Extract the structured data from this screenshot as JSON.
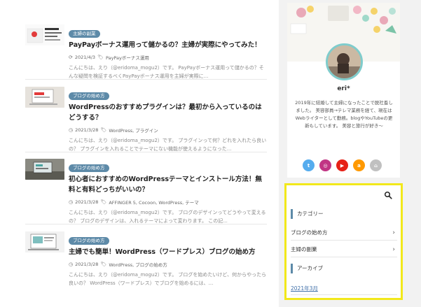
{
  "posts": [
    {
      "category": "主婦の副業",
      "title": "PayPayボーナス運用って儲かるの？主婦が実際にやってみた！",
      "date": "2021/4/3",
      "date_icon": "refresh-icon",
      "tags": "PayPayボーナス運用",
      "excerpt": "こんにちは、えり（@eridoma_mogu2）です。 PayPayボーナス運用って儲かるの？そんな疑問を検証するべくPayPayボーナス運用を主婦が実際に..."
    },
    {
      "category": "ブログの始め方",
      "title": "WordPressのおすすめプラグインは？最初から入っているのはどうする？",
      "date": "2021/3/28",
      "date_icon": "clock-icon",
      "tags": "WordPress, プラグイン",
      "excerpt": "こんにちは、えり（@eridoma_mogu2）です。 プラグインって何？どれを入れたら良いの？ プラグインを入れることでテーマにない機能が使えるようになった..."
    },
    {
      "category": "ブログの始め方",
      "title": "初心者におすすめのWordPressテーマとインストール方法！無料と有料どっちがいいの？",
      "date": "2021/3/28",
      "date_icon": "clock-icon",
      "tags": "AFFINGER 5, Cocoon, WordPress, テーマ",
      "excerpt": "こんにちは、えり（@eridoma_mogu2）です。 ブログのデザインってどうやって変えるの？ ブログのデザインは、入れるテーマによって変わります。 この記..."
    },
    {
      "category": "ブログの始め方",
      "title": "主婦でも簡単！WordPress（ワードプレス）ブログの始め方",
      "date": "2021/3/28",
      "date_icon": "clock-icon",
      "tags": "WordPress, ブログの始め方",
      "excerpt": "こんにちは、えり（@eridoma_mogu2）です。 ブログを始めたいけど、何からやったら良いの？ WordPress（ワードプレス）でブログを始めるには、..."
    }
  ],
  "profile": {
    "name": "eri*",
    "bio": "2019年に結婚して主婦になったことで脱社畜しました。 美容部員→テレマ業務を経て、現在はWebライターとして勤務。blogやYouTubeの更新もしています。 美容と旅行が好き〜"
  },
  "socials": [
    {
      "icon": "twitter-icon",
      "glyph": "t",
      "color": "#55acee"
    },
    {
      "icon": "instagram-icon",
      "glyph": "◎",
      "color": "#c13584"
    },
    {
      "icon": "youtube-icon",
      "glyph": "▶",
      "color": "#e62117"
    },
    {
      "icon": "amazon-icon",
      "glyph": "a",
      "color": "#ff9900"
    },
    {
      "icon": "home-icon",
      "glyph": "⌂",
      "color": "#c0c0c0"
    }
  ],
  "widget": {
    "search_icon": "search-icon",
    "category_title": "カテゴリー",
    "categories": [
      "ブログの始め方",
      "主婦の副業"
    ],
    "archive_title": "アーカイブ",
    "archive_item": "2021年3月"
  },
  "colors": {
    "accent": "#5d8aa8",
    "highlight_border": "#f2e81b",
    "link": "#3d6ea8"
  }
}
